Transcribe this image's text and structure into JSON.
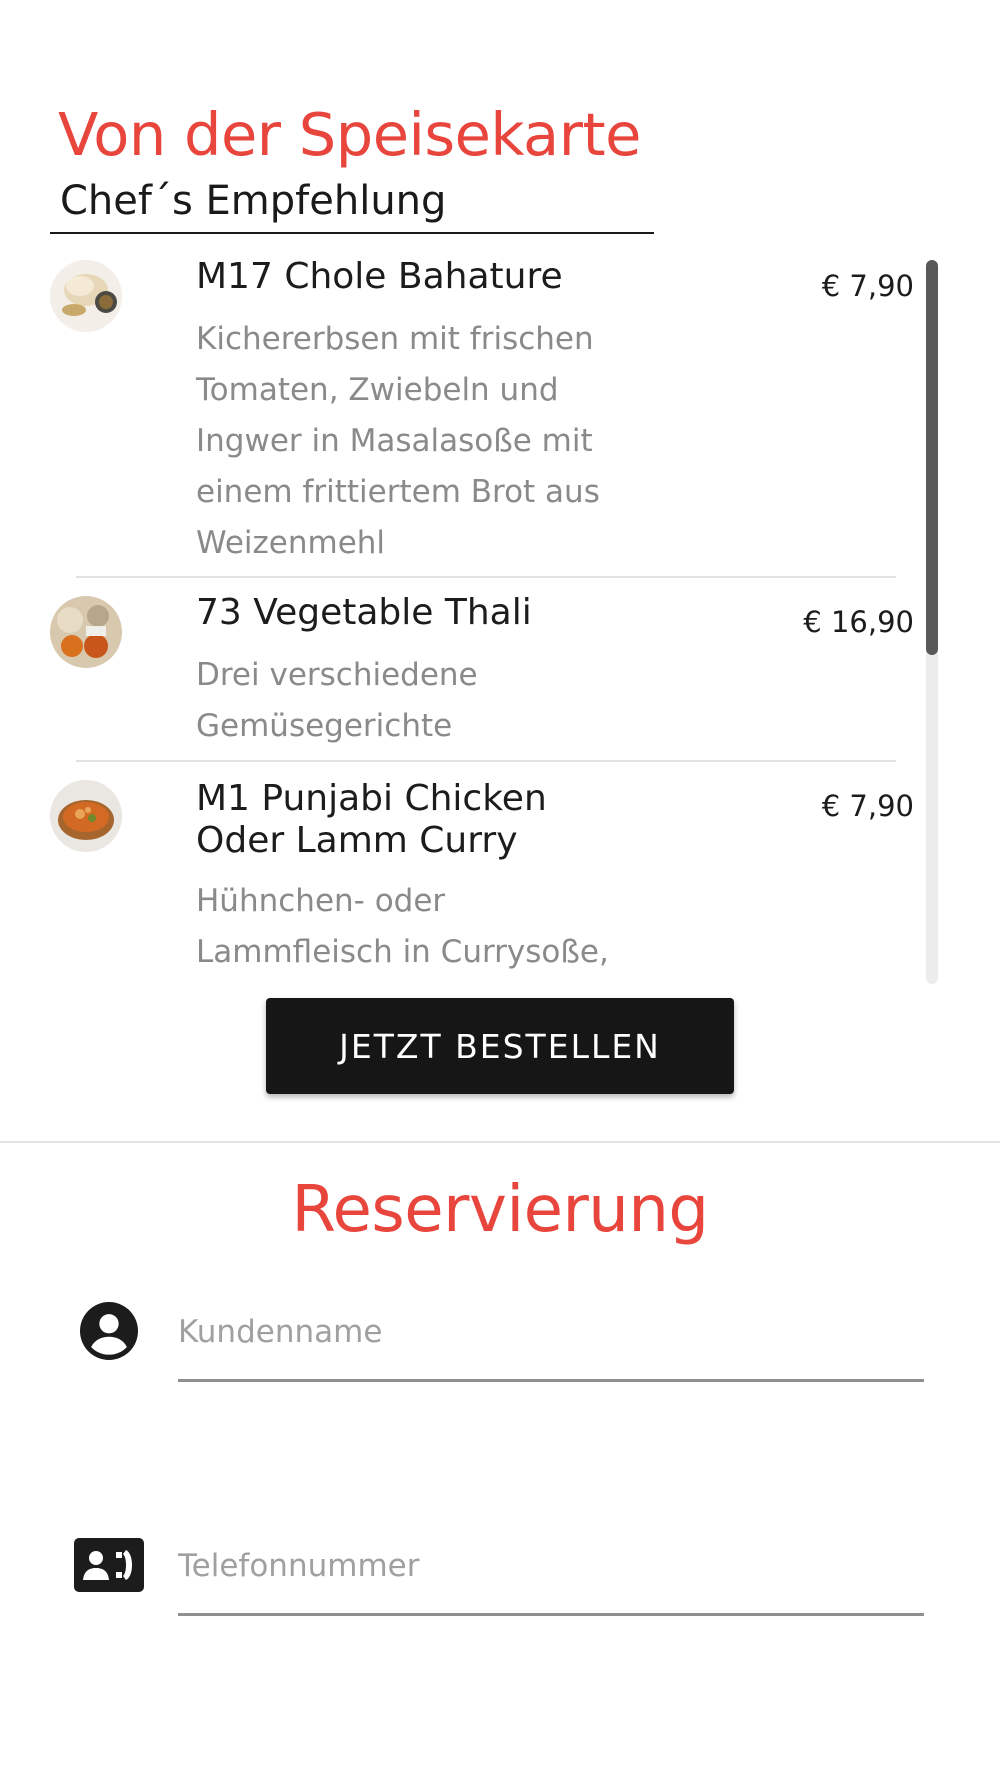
{
  "menu": {
    "title": "Von der Speisekarte",
    "category": "Chef´s Empfehlung",
    "items": [
      {
        "name": "M17 Chole Bahature",
        "description": "Kichererbsen mit frischen Tomaten, Zwiebeln und Ingwer in Masalasoße mit einem frittiertem Brot aus Weizenmehl",
        "price": "€ 7,90",
        "thumbnail_icon": "food-photo"
      },
      {
        "name": "73 Vegetable Thali",
        "description": "Drei verschiedene Gemüsegerichte",
        "price": "€ 16,90",
        "thumbnail_icon": "food-photo"
      },
      {
        "name": "M1 Punjabi Chicken Oder Lamm Curry",
        "description": "Hühnchen- oder Lammfleisch in Currysoße,",
        "price": "€ 7,90",
        "thumbnail_icon": "food-photo"
      }
    ],
    "scroll_position": 0.0,
    "order_button_label": "JETZT BESTELLEN"
  },
  "reservation": {
    "title": "Reservierung",
    "fields": [
      {
        "icon": "account-circle-icon",
        "placeholder": "Kundenname",
        "value": ""
      },
      {
        "icon": "contact-phone-icon",
        "placeholder": "Telefonnummer",
        "value": ""
      }
    ]
  },
  "colors": {
    "accent": "#e8453c",
    "button_bg": "#161616",
    "text_primary": "#1c1c1c",
    "text_secondary": "#8a8a8a",
    "divider": "#e2e2e2"
  }
}
